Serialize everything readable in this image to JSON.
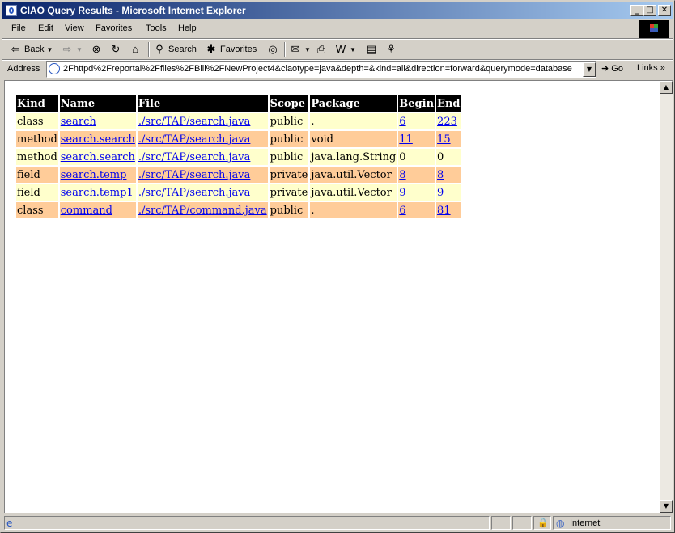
{
  "window": {
    "title": "CIAO Query Results - Microsoft Internet Explorer",
    "minimize": "_",
    "maximize": "□",
    "close": "✕"
  },
  "menu": [
    "File",
    "Edit",
    "View",
    "Favorites",
    "Tools",
    "Help"
  ],
  "toolbar": {
    "back_label": "Back",
    "search_label": "Search",
    "favorites_label": "Favorites"
  },
  "address": {
    "label": "Address",
    "url": "2Fhttpd%2Freportal%2Ffiles%2FBill%2FNewProject4&ciaotype=java&depth=&kind=all&direction=forward&querymode=database",
    "go_label": "Go",
    "links_label": "Links"
  },
  "table": {
    "headers": [
      "Kind",
      "Name",
      "File",
      "Scope",
      "Package",
      "Begin",
      "End"
    ],
    "rows": [
      {
        "kind": "class",
        "name": "search",
        "file": "./src/TAP/search.java",
        "scope": "public",
        "package": ".",
        "begin": "6",
        "end": "223",
        "begin_link": true,
        "end_link": true
      },
      {
        "kind": "method",
        "name": "search.search",
        "file": "./src/TAP/search.java",
        "scope": "public",
        "package": "void",
        "begin": "11",
        "end": "15",
        "begin_link": true,
        "end_link": true
      },
      {
        "kind": "method",
        "name": "search.search",
        "file": "./src/TAP/search.java",
        "scope": "public",
        "package": "java.lang.String",
        "begin": "0",
        "end": "0",
        "begin_link": false,
        "end_link": false
      },
      {
        "kind": "field",
        "name": "search.temp",
        "file": "./src/TAP/search.java",
        "scope": "private",
        "package": "java.util.Vector",
        "begin": "8",
        "end": "8",
        "begin_link": true,
        "end_link": true
      },
      {
        "kind": "field",
        "name": "search.temp1",
        "file": "./src/TAP/search.java",
        "scope": "private",
        "package": "java.util.Vector",
        "begin": "9",
        "end": "9",
        "begin_link": true,
        "end_link": true
      },
      {
        "kind": "class",
        "name": "command",
        "file": "./src/TAP/command.java",
        "scope": "public",
        "package": ".",
        "begin": "6",
        "end": "81",
        "begin_link": true,
        "end_link": true
      }
    ]
  },
  "status": {
    "zone": "Internet"
  },
  "colors": {
    "row_odd": "#ffffcc",
    "row_even": "#ffcc99",
    "header_bg": "#000000",
    "link": "#0000ee"
  }
}
